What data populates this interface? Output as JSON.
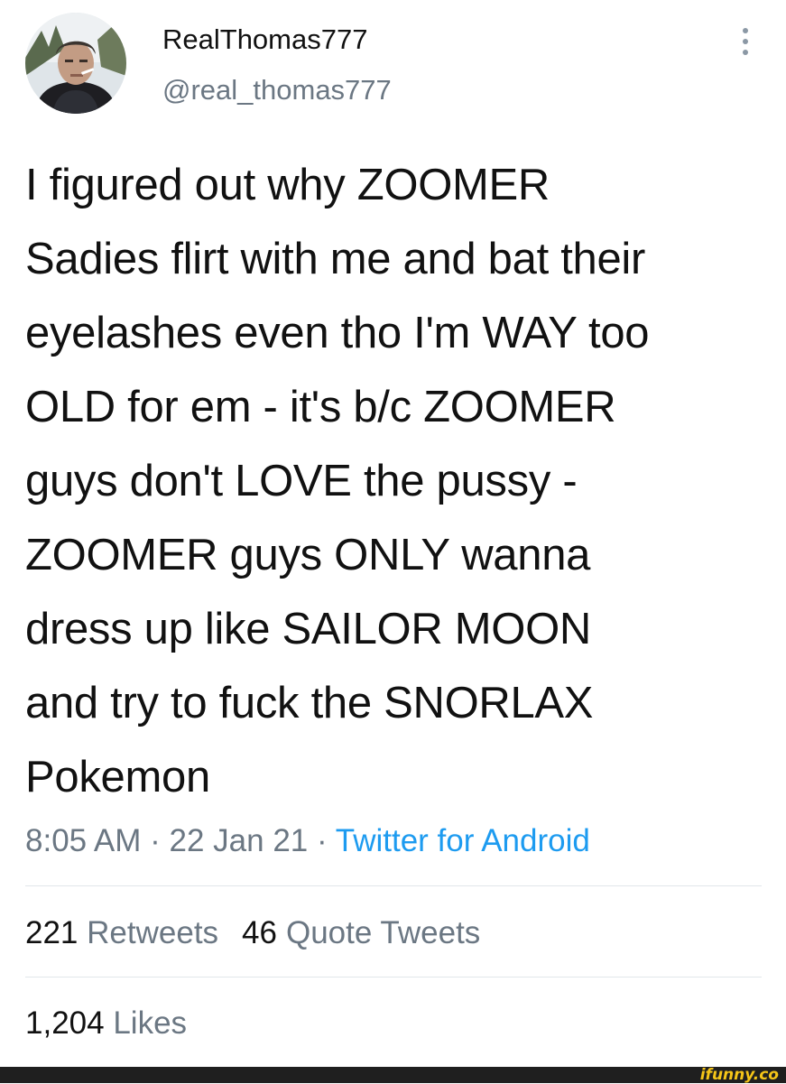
{
  "header": {
    "display_name": "RealThomas777",
    "handle": "@real_thomas777",
    "avatar_icon": "profile-photo",
    "more_icon": "more-vertical-icon"
  },
  "tweet": {
    "lines": [
      "I figured out why ZOOMER",
      "Sadies flirt with me and bat their",
      "eyelashes even tho I'm WAY too",
      "OLD for em - it's b/c ZOOMER",
      "guys don't LOVE the pussy -",
      "ZOOMER guys ONLY wanna",
      "dress up like SAILOR MOON",
      "and try to fuck the SNORLAX",
      "Pokemon"
    ]
  },
  "meta": {
    "time": "8:05 AM",
    "separator": " · ",
    "date": "22 Jan 21",
    "source": "Twitter for Android"
  },
  "stats": {
    "retweets_count": "221",
    "retweets_label": "Retweets",
    "quotes_count": "46",
    "quotes_label": "Quote Tweets",
    "likes_count": "1,204",
    "likes_label": "Likes"
  },
  "watermark": {
    "text": "ifunny.co"
  },
  "colors": {
    "text": "#111111",
    "secondary": "#6b7783",
    "link": "#1d9bf0",
    "divider": "#e1e6ea"
  }
}
